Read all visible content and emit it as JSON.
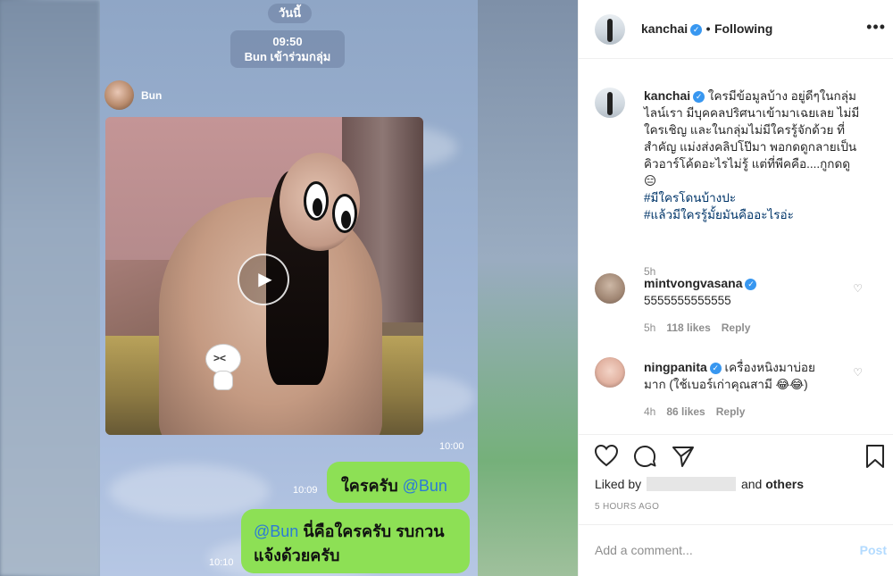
{
  "media": {
    "date_label": "วันนี้",
    "join_time": "09:50",
    "join_text": "Bun เข้าร่วมกลุ่ม",
    "sender_name": "Bun",
    "video_time": "10:00",
    "msg1_time": "10:09",
    "msg1_text": "ใครครับ ",
    "msg1_mention": "@Bun",
    "msg2_time": "10:10",
    "msg2_mention": "@Bun",
    "msg2_line1": " นี่คือใครครับ รบกวน",
    "msg2_line2": "แจ้งด้วยครับ"
  },
  "header": {
    "username": "kanchai",
    "dot": "•",
    "follow_label": "Following",
    "more_icon": "more-options-icon"
  },
  "caption": {
    "username": "kanchai",
    "lines": [
      "ใครมีข้อมูลบ้าง อยู่ดีๆในกลุ่ม",
      "ไลน์เรา มีบุคคลปริศนาเข้ามาเฉยเลย ไม่มี",
      "ใครเชิญ และในกลุ่มไม่มีใครรู้จักด้วย ที่",
      "สำคัญ แม่งส่งคลิปโป๊มา พอกดดูกลายเป็น",
      "คิวอาร์โค้ดอะไรไม่รู้ แต่ที่พีคคือ....กูกดดู"
    ],
    "emoji": "😑",
    "hashtags": [
      "#มีใครโดนบ้างปะ",
      "#แล้วมีใครรู้มั้ยมันคืออะไรอ่ะ"
    ],
    "time": "5h"
  },
  "comments": [
    {
      "username": "mintvongvasana",
      "text": "5555555555555",
      "time": "5h",
      "likes": "118 likes",
      "reply": "Reply"
    },
    {
      "username": "ningpanita",
      "text_line1": "เครื่องหนิงมาบ่อย",
      "text_line2": "มาก (ใช้เบอร์เก่าคุณสามี 😂😂)",
      "time": "4h",
      "likes": "86 likes",
      "reply": "Reply"
    }
  ],
  "actions": {
    "liked_by_prefix": "Liked by",
    "and_label": "and",
    "others_label": "others",
    "posted_ago": "5 HOURS AGO"
  },
  "add_comment": {
    "placeholder": "Add a comment...",
    "post_label": "Post"
  },
  "colors": {
    "line_green": "#8de055",
    "verified_blue": "#3897f0",
    "mention_blue": "#2b7bd6"
  }
}
